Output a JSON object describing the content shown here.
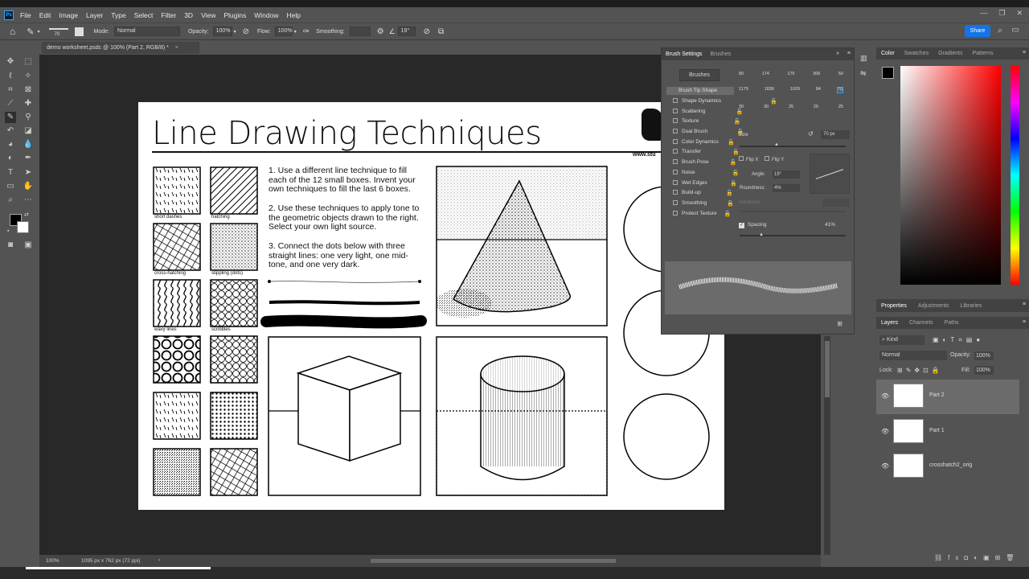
{
  "menu": {
    "items": [
      "File",
      "Edit",
      "Image",
      "Layer",
      "Type",
      "Select",
      "Filter",
      "3D",
      "View",
      "Plugins",
      "Window",
      "Help"
    ]
  },
  "window_controls": [
    "—",
    "❐",
    "✕"
  ],
  "options": {
    "size_value": "70",
    "mode_label": "Mode:",
    "mode_value": "Normal",
    "opacity_label": "Opacity:",
    "opacity_value": "100%",
    "flow_label": "Flow:",
    "flow_value": "100%",
    "smoothing_label": "Smoothing:",
    "angle_value": "19°",
    "share_label": "Share"
  },
  "doc": {
    "tab_title": "demo worksheet.psdc @ 100% (Part 2, RGB/8) *",
    "zoom": "100%",
    "dimensions": "1095 px x 762 px (72 ppi)"
  },
  "worksheet": {
    "title": "Line Drawing Techniques",
    "website": "www.stu",
    "box_labels": [
      "short dashes",
      "hatching",
      "cross-hatching",
      "stippling (dots)",
      "wavy lines",
      "scribbles"
    ],
    "instructions": [
      "1. Use a different line technique to fill each of the 12 small boxes. Invent your own techniques to fill the last 6 boxes.",
      "2. Use these techniques to apply tone to the geometric objects drawn to the right. Select your own light source.",
      "3. Connect the dots below with three straight lines: one very light, one mid-tone, and one very dark."
    ]
  },
  "brush_settings": {
    "tabs": [
      "Brush Settings",
      "Brushes"
    ],
    "brushes_button": "Brushes",
    "options": [
      "Brush Tip Shape",
      "Shape Dynamics",
      "Scattering",
      "Texture",
      "Dual Brush",
      "Color Dynamics",
      "Transfer",
      "Brush Pose",
      "Noise",
      "Wet Edges",
      "Build-up",
      "Smoothing",
      "Protect Texture"
    ],
    "tip_sizes_row1": [
      "80",
      "174",
      "175",
      "306",
      "50"
    ],
    "tip_sizes_row2": [
      "1179",
      "1836",
      "1029",
      "84",
      "70"
    ],
    "tip_sizes_row3": [
      "30",
      "30",
      "25",
      "25",
      "25"
    ],
    "size_label": "Size",
    "size_value": "70 px",
    "flip_x": "Flip X",
    "flip_y": "Flip Y",
    "angle_label": "Angle:",
    "angle_value": "19°",
    "roundness_label": "Roundness:",
    "roundness_value": "4%",
    "hardness_label": "Hardness",
    "spacing_label": "Spacing",
    "spacing_value": "41%"
  },
  "color_panel": {
    "tabs": [
      "Color",
      "Swatches",
      "Gradients",
      "Patterns"
    ],
    "foreground": "#000000",
    "background": "#ffffff"
  },
  "properties_panel": {
    "tabs": [
      "Properties",
      "Adjustments",
      "Libraries"
    ]
  },
  "layers_panel": {
    "tabs": [
      "Layers",
      "Channels",
      "Paths"
    ],
    "kind_label": "Kind",
    "blend_mode": "Normal",
    "opacity_label": "Opacity:",
    "opacity_value": "100%",
    "lock_label": "Lock:",
    "fill_label": "Fill:",
    "fill_value": "100%",
    "layers": [
      {
        "name": "Part 2"
      },
      {
        "name": "Part 1"
      },
      {
        "name": "crosshatch2_orig"
      }
    ]
  }
}
